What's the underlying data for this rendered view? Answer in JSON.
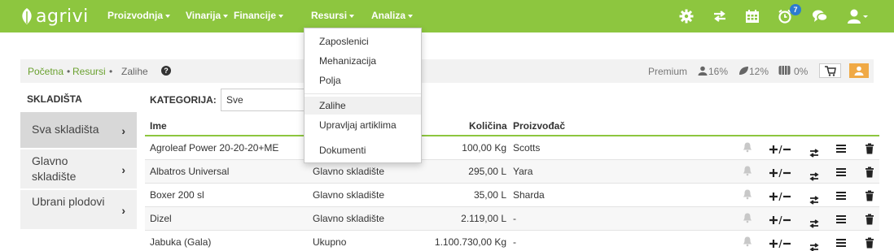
{
  "brand": {
    "name": "agrivi"
  },
  "nav": {
    "items": [
      {
        "label": "Proizvodnja"
      },
      {
        "label": "Vinarija"
      },
      {
        "label": "Financije"
      },
      {
        "label": "Resursi"
      },
      {
        "label": "Analiza"
      }
    ],
    "icons": [
      "gear-icon",
      "transfer-icon",
      "calendar-icon",
      "alarm-icon",
      "chat-icon",
      "user-icon"
    ],
    "notification_count": "7"
  },
  "dropdown": {
    "items": [
      {
        "label": "Zaposlenici"
      },
      {
        "label": "Mehanizacija"
      },
      {
        "label": "Polja"
      },
      {
        "label": "Zalihe"
      },
      {
        "label": "Upravljaj artiklima"
      },
      {
        "label": "Dokumenti"
      }
    ]
  },
  "breadcrumb": {
    "home": "Početna",
    "sep1": "•",
    "section": "Resursi",
    "sep2": "•",
    "current": "Zalihe",
    "help": "?"
  },
  "stats": {
    "plan": "Premium",
    "users": "16%",
    "area": "12%",
    "storage": "0%"
  },
  "sidebar": {
    "title": "SKLADIŠTA",
    "items": [
      {
        "label": "Sva skladišta"
      },
      {
        "label": "Glavno skladište"
      },
      {
        "label": "Ubrani plodovi"
      }
    ]
  },
  "category": {
    "label": "KATEGORIJA:",
    "value": "Sve"
  },
  "table": {
    "headers": {
      "name": "Ime",
      "quantity": "Količina",
      "manufacturer": "Proizvođač"
    },
    "rows": [
      {
        "name": "Agroleaf Power 20-20-20+ME",
        "warehouse": "",
        "quantity": "100,00 Kg",
        "manufacturer": "Scotts"
      },
      {
        "name": "Albatros Universal",
        "warehouse": "Glavno skladište",
        "quantity": "295,00 L",
        "manufacturer": "Yara"
      },
      {
        "name": "Boxer 200 sl",
        "warehouse": "Glavno skladište",
        "quantity": "35,00 L",
        "manufacturer": "Sharda"
      },
      {
        "name": "Dizel",
        "warehouse": "Glavno skladište",
        "quantity": "2.119,00 L",
        "manufacturer": "-"
      },
      {
        "name": "Jabuka (Gala)",
        "warehouse": "Ukupno",
        "quantity": "1.100.730,00 Kg",
        "manufacturer": "-"
      }
    ],
    "row_actions": [
      "bell-icon",
      "plus-minus-icon",
      "transfer-icon",
      "list-icon",
      "trash-icon"
    ]
  },
  "colors": {
    "brand_green": "#8dc63f",
    "link_green": "#6aa12f",
    "badge_blue": "#2d7bd1",
    "user_orange": "#f0a945"
  }
}
